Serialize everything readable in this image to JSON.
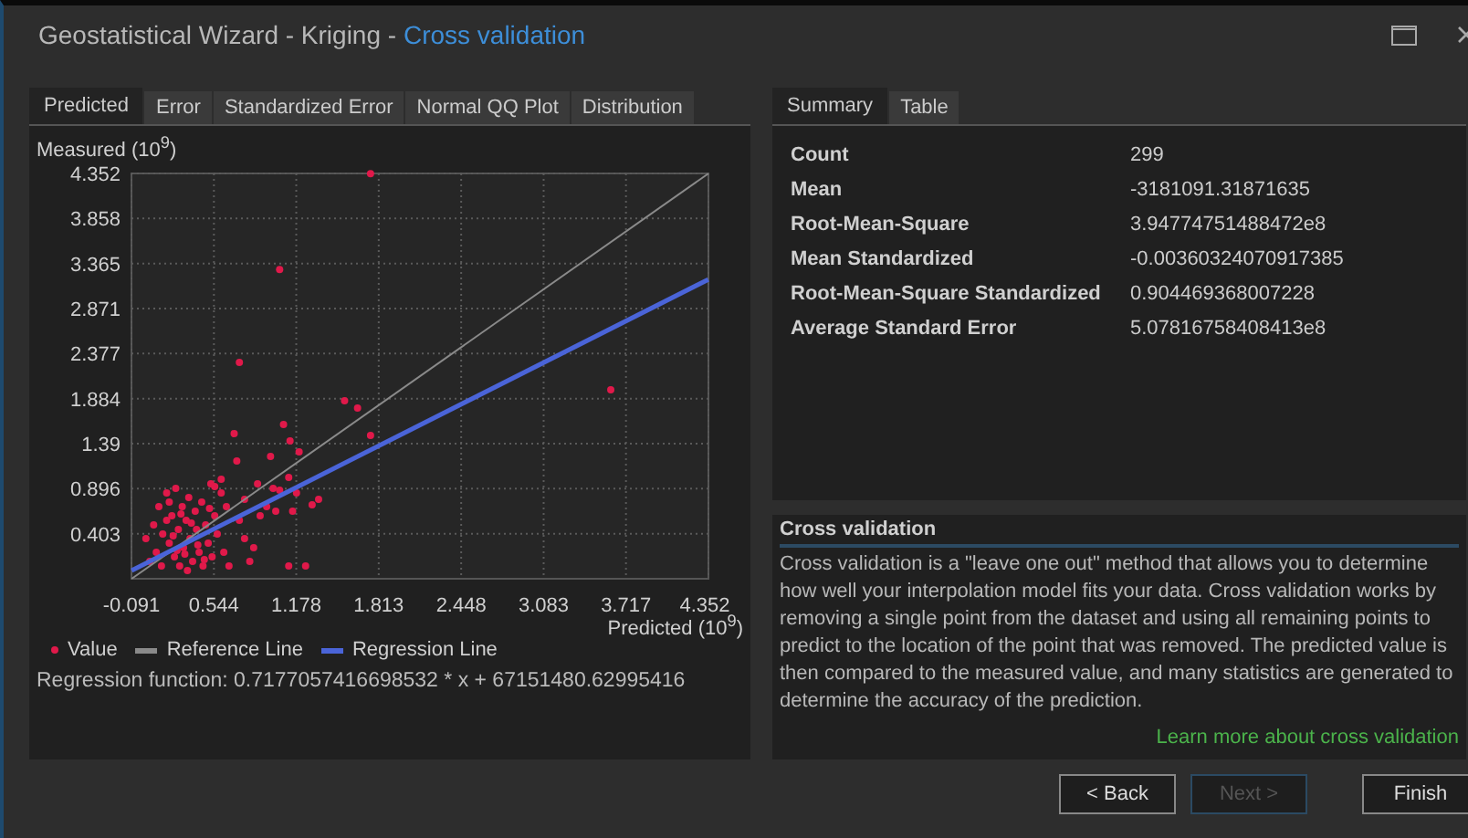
{
  "window": {
    "title": "Geostatistical Wizard - Kriging - ",
    "step": "Cross validation"
  },
  "chart_tabs": [
    {
      "label": "Predicted",
      "selected": true
    },
    {
      "label": "Error",
      "selected": false
    },
    {
      "label": "Standardized Error",
      "selected": false
    },
    {
      "label": "Normal QQ Plot",
      "selected": false
    },
    {
      "label": "Distribution",
      "selected": false
    }
  ],
  "chart": {
    "chart_data": {
      "type": "scatter",
      "grid": true,
      "xlabel": "Predicted (10$^{9}$)",
      "ylabel": "Measured (10$^{9}$)",
      "xlim": [
        -0.091,
        4.352
      ],
      "ylim": [
        -0.091,
        4.352
      ],
      "xticks": [
        -0.091,
        0.544,
        1.178,
        1.813,
        2.448,
        3.083,
        3.717,
        4.352
      ],
      "yticks": [
        0.403,
        0.896,
        {
          "value": 1.39,
          "label": "1.39"
        },
        1.884,
        2.377,
        2.871,
        3.365,
        3.858,
        4.352
      ],
      "series": [
        {
          "name": "Value",
          "color": "#e0194a",
          "x": [
            0.02,
            0.05,
            0.08,
            0.1,
            0.12,
            0.14,
            0.15,
            0.18,
            0.2,
            0.22,
            0.24,
            0.25,
            0.27,
            0.28,
            0.3,
            0.31,
            0.33,
            0.34,
            0.35,
            0.36,
            0.38,
            0.4,
            0.41,
            0.43,
            0.45,
            0.46,
            0.48,
            0.5,
            0.52,
            0.53,
            0.55,
            0.57,
            0.6,
            0.62,
            0.64,
            0.66,
            0.18,
            0.23,
            0.29,
            0.32,
            0.37,
            0.42,
            0.47,
            0.51,
            0.26,
            0.2,
            0.74,
            0.78,
            0.82,
            0.88,
            0.95,
            1.0,
            1.05,
            1.12,
            1.15,
            1.18,
            0.98,
            0.72,
            0.7,
            1.08,
            1.13,
            1.2,
            0.74,
            1.05,
            1.75,
            1.55,
            1.65,
            1.75,
            3.6,
            1.12,
            1.25,
            0.85,
            0.78,
            0.9,
            1.02,
            1.3,
            1.35,
            0.6,
            0.55
          ],
          "values": [
            0.35,
            0.1,
            0.5,
            0.2,
            0.7,
            0.05,
            0.4,
            0.85,
            0.3,
            0.6,
            0.15,
            0.9,
            0.45,
            0.05,
            0.7,
            0.25,
            0.55,
            0.0,
            0.8,
            0.35,
            0.1,
            0.65,
            0.45,
            0.2,
            0.75,
            0.05,
            0.5,
            0.3,
            0.95,
            0.15,
            0.6,
            0.4,
            0.85,
            0.2,
            0.7,
            0.05,
            0.55,
            0.38,
            0.62,
            0.18,
            0.52,
            0.28,
            0.12,
            0.68,
            0.22,
            0.75,
            0.55,
            0.78,
            0.1,
            0.95,
            0.7,
            0.9,
            0.88,
            1.02,
            0.65,
            0.85,
            1.25,
            1.2,
            1.5,
            1.6,
            1.42,
            1.3,
            2.28,
            3.3,
            4.35,
            1.86,
            1.78,
            1.48,
            1.98,
            0.05,
            0.05,
            0.25,
            0.35,
            0.6,
            0.65,
            0.72,
            0.78,
            1.0,
            0.92
          ]
        },
        {
          "name": "Reference Line",
          "color": "#8a8a8a",
          "type": "line",
          "x": [
            -0.09,
            4.35
          ],
          "values": [
            -0.09,
            4.35
          ]
        },
        {
          "name": "Regression Line",
          "color": "#4a64d8",
          "type": "line",
          "x": [
            -0.09,
            4.35
          ],
          "values": [
            0.0,
            3.19
          ]
        }
      ]
    },
    "regression": "Regression function: 0.7177057416698532 * x + 67151480.62995416"
  },
  "summary_tabs": [
    {
      "label": "Summary",
      "selected": true
    },
    {
      "label": "Table",
      "selected": false
    }
  ],
  "summary": [
    {
      "label": "Count",
      "value": "299"
    },
    {
      "label": "Mean",
      "value": "-3181091.31871635"
    },
    {
      "label": "Root-Mean-Square",
      "value": "3.94774751488472e8"
    },
    {
      "label": "Mean Standardized",
      "value": "-0.00360324070917385"
    },
    {
      "label": "Root-Mean-Square Standardized",
      "value": "0.904469368007228"
    },
    {
      "label": "Average Standard Error",
      "value": "5.07816758408413e8"
    }
  ],
  "help": {
    "title": "Cross validation",
    "text": "Cross validation is a \"leave one out\" method that allows you to determine how well your interpolation model fits your data. Cross validation works by removing a single point from the dataset and using all remaining points to predict to the location of the point that was removed. The predicted value is then compared to the measured value, and many statistics are generated to determine the accuracy of the prediction.",
    "link": "Learn more about cross validation"
  },
  "buttons": [
    {
      "label": "< Back",
      "disabled": false
    },
    {
      "label": "Next >",
      "disabled": true
    },
    {
      "label": "Finish",
      "disabled": false
    }
  ]
}
